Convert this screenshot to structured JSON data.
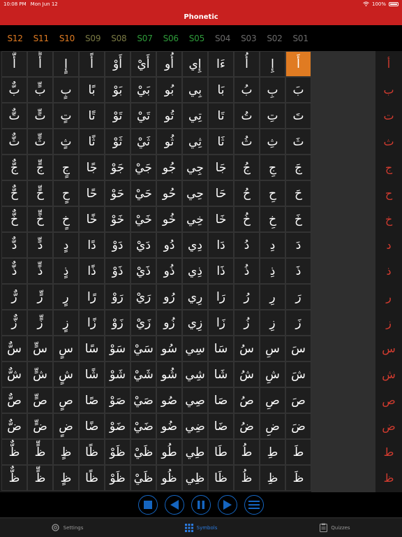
{
  "status": {
    "time": "10:08 PM",
    "date": "Mon Jun 12",
    "battery": "100%"
  },
  "nav": {
    "title": "Phonetic"
  },
  "sections": [
    {
      "label": "S12",
      "color": "#e07b22"
    },
    {
      "label": "S11",
      "color": "#e07b22"
    },
    {
      "label": "S10",
      "color": "#e07b22"
    },
    {
      "label": "S09",
      "color": "#7a7a44"
    },
    {
      "label": "S08",
      "color": "#7a7a44"
    },
    {
      "label": "S07",
      "color": "#2e9b3a"
    },
    {
      "label": "S06",
      "color": "#2e9b3a"
    },
    {
      "label": "S05",
      "color": "#2e9b3a"
    },
    {
      "label": "S04",
      "color": "#6b6b6b"
    },
    {
      "label": "S03",
      "color": "#6b6b6b"
    },
    {
      "label": "S02",
      "color": "#6b6b6b"
    },
    {
      "label": "S01",
      "color": "#6b6b6b"
    }
  ],
  "grid": [
    [
      "أٌّ",
      "أٍّ",
      "إٍ",
      "أً",
      "أَوْ",
      "أَيْ",
      "أُو",
      "إِي",
      "ءَا",
      "أُ",
      "إِ",
      "أَ",
      "أْ"
    ],
    [
      "بٌّ",
      "بٍّ",
      "بٍ",
      "بًا",
      "بَوْ",
      "بَيْ",
      "بُو",
      "بِي",
      "بَا",
      "بُ",
      "بِ",
      "بَ",
      "بْ"
    ],
    [
      "تٌّ",
      "تٍّ",
      "تٍ",
      "تًا",
      "تَوْ",
      "تَيْ",
      "تُو",
      "تِي",
      "تَا",
      "تُ",
      "تِ",
      "تَ",
      "تْ"
    ],
    [
      "ثٌّ",
      "ثٍّ",
      "ثٍ",
      "ثًا",
      "ثَوْ",
      "ثَيْ",
      "ثُو",
      "ثِي",
      "ثَا",
      "ثُ",
      "ثِ",
      "ثَ",
      "ثْ"
    ],
    [
      "جٌّ",
      "جٍّ",
      "جٍ",
      "جًا",
      "جَوْ",
      "جَيْ",
      "جُو",
      "جِي",
      "جَا",
      "جُ",
      "جِ",
      "جَ",
      "جْ"
    ],
    [
      "حٌّ",
      "حٍّ",
      "حٍ",
      "حًا",
      "حَوْ",
      "حَيْ",
      "حُو",
      "حِي",
      "حَا",
      "حُ",
      "حِ",
      "حَ",
      "حْ"
    ],
    [
      "خٌّ",
      "خٍّ",
      "خٍ",
      "خًا",
      "خَوْ",
      "خَيْ",
      "خُو",
      "خِي",
      "خَا",
      "خُ",
      "خِ",
      "خَ",
      "خْ"
    ],
    [
      "دٌّ",
      "دٍّ",
      "دٍ",
      "دًا",
      "دَوْ",
      "دَيْ",
      "دُو",
      "دِي",
      "دَا",
      "دُ",
      "دِ",
      "دَ",
      "دْ"
    ],
    [
      "ذٌّ",
      "ذٍّ",
      "ذٍ",
      "ذًا",
      "ذَوْ",
      "ذَيْ",
      "ذُو",
      "ذِي",
      "ذَا",
      "ذُ",
      "ذِ",
      "ذَ",
      "ذْ"
    ],
    [
      "رٌّ",
      "رٍّ",
      "رٍ",
      "رًا",
      "رَوْ",
      "رَيْ",
      "رُو",
      "رِي",
      "رَا",
      "رُ",
      "رِ",
      "رَ",
      "رْ"
    ],
    [
      "زٌّ",
      "زٍّ",
      "زٍ",
      "زًا",
      "زَوْ",
      "زَيْ",
      "زُو",
      "زِي",
      "زَا",
      "زُ",
      "زِ",
      "زَ",
      "زْ"
    ],
    [
      "سٌّ",
      "سٍّ",
      "سٍ",
      "سًا",
      "سَوْ",
      "سَيْ",
      "سُو",
      "سِي",
      "سَا",
      "سُ",
      "سِ",
      "سَ",
      "سْ"
    ],
    [
      "شٌّ",
      "شٍّ",
      "شٍ",
      "شًا",
      "شَوْ",
      "شَيْ",
      "شُو",
      "شِي",
      "شَا",
      "شُ",
      "شِ",
      "شَ",
      "شْ"
    ],
    [
      "صٌّ",
      "صٍّ",
      "صٍ",
      "صًا",
      "صَوْ",
      "صَيْ",
      "صُو",
      "صِي",
      "صَا",
      "صُ",
      "صِ",
      "صَ",
      "صْ"
    ],
    [
      "ضٌّ",
      "ضٍّ",
      "ضٍ",
      "ضًا",
      "ضَوْ",
      "ضَيْ",
      "ضُو",
      "ضِي",
      "ضَا",
      "ضُ",
      "ضِ",
      "ضَ",
      "ضْ"
    ],
    [
      "ظٌّ",
      "ظٍّ",
      "ظٍ",
      "ظًا",
      "ظَوْ",
      "ظَيْ",
      "طُو",
      "طِي",
      "طَا",
      "طُ",
      "طِ",
      "طَ",
      "ظْ"
    ],
    [
      "ظٌّ",
      "ظٍّ",
      "ظٍ",
      "ظًا",
      "ظَوْ",
      "ظَيْ",
      "ظُو",
      "ظِي",
      "ظَا",
      "ظُ",
      "ظِ",
      "ظَ",
      "ظْ"
    ]
  ],
  "letters": [
    "أ",
    "ب",
    "ت",
    "ث",
    "ج",
    "ح",
    "خ",
    "د",
    "ذ",
    "ر",
    "ز",
    "س",
    "ش",
    "ص",
    "ض",
    "ط",
    "ظ"
  ],
  "player": {
    "color": "#1565c0"
  },
  "tabs": [
    {
      "label": "Settings",
      "icon": "gear-icon"
    },
    {
      "label": "Symbols",
      "icon": "grid-icon"
    },
    {
      "label": "Quizzes",
      "icon": "clipboard-icon"
    }
  ]
}
